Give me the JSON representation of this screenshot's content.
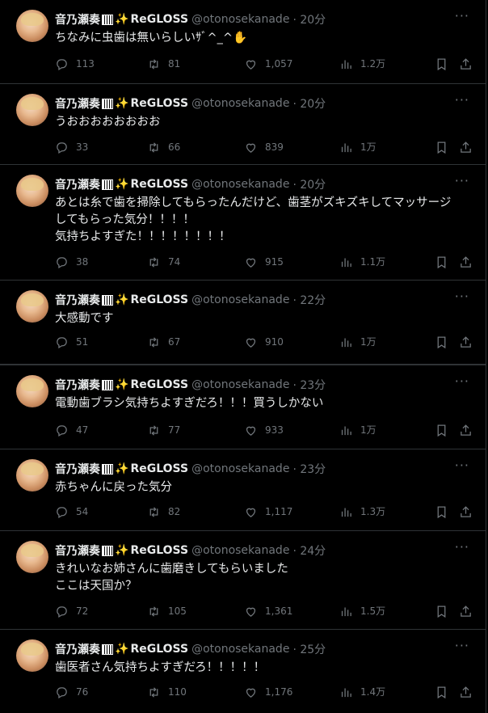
{
  "account": {
    "display_name": "音乃瀬奏",
    "group": "ReGLOSS",
    "handle": "@otonosekanade"
  },
  "tweets": [
    {
      "time": "· 20分",
      "text": "ちなみに虫歯は無いらしいｻﾞ^_^✋",
      "replies": "113",
      "retweets": "81",
      "likes": "1,057",
      "views": "1.2万"
    },
    {
      "time": "· 20分",
      "text": "うおおおおおおおお",
      "replies": "33",
      "retweets": "66",
      "likes": "839",
      "views": "1万"
    },
    {
      "time": "· 20分",
      "text": "あとは糸で歯を掃除してもらったんだけど、歯茎がズキズキしてマッサージ\nしてもらった気分！！！！\n気持ちよすぎた！！！！！！！！",
      "replies": "38",
      "retweets": "74",
      "likes": "915",
      "views": "1.1万"
    },
    {
      "time": "· 22分",
      "text": "大感動です",
      "replies": "51",
      "retweets": "67",
      "likes": "910",
      "views": "1万"
    },
    {
      "time": "· 23分",
      "text": "電動歯ブラシ気持ちよすぎだろ！！！買うしかない",
      "replies": "47",
      "retweets": "77",
      "likes": "933",
      "views": "1万"
    },
    {
      "time": "· 23分",
      "text": "赤ちゃんに戻った気分",
      "replies": "54",
      "retweets": "82",
      "likes": "1,117",
      "views": "1.3万"
    },
    {
      "time": "· 24分",
      "text": "きれいなお姉さんに歯磨きしてもらいました\nここは天国か？",
      "replies": "72",
      "retweets": "105",
      "likes": "1,361",
      "views": "1.5万"
    },
    {
      "time": "· 25分",
      "text": "歯医者さん気持ちよすぎだろ！！！！！",
      "replies": "76",
      "retweets": "110",
      "likes": "1,176",
      "views": "1.4万"
    }
  ],
  "icons": {
    "more": "more-icon",
    "reply": "reply-icon",
    "retweet": "retweet-icon",
    "like": "heart-icon",
    "views": "views-icon",
    "bookmark": "bookmark-icon",
    "share": "share-icon",
    "badge_1": "piano-icon",
    "badge_2": "sparkle-icon"
  },
  "colors": {
    "background": "#000000",
    "text": "#e7e9ea",
    "muted": "#71767b",
    "divider": "#2f3336"
  }
}
